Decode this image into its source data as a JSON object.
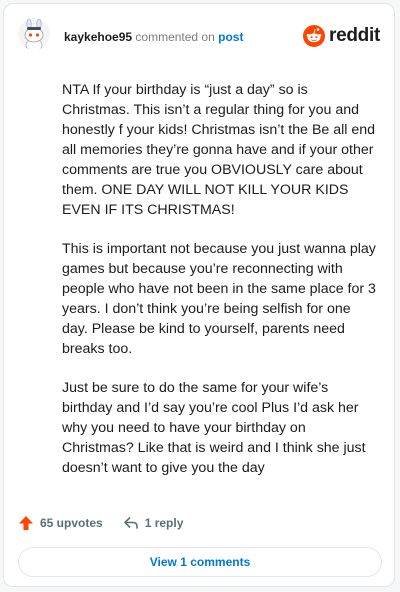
{
  "header": {
    "username": "kaykehoe95",
    "action_text": "commented on",
    "post_link": "post",
    "brand": "reddit"
  },
  "comment": {
    "paragraphs": [
      "NTA If your birthday is “just a day” so is Christmas. This isn’t a regular thing for you and honestly f your kids! Christmas isn’t the Be all end all memories they’re gonna have and if your other comments are true you OBVIOUSLY care about them. ONE DAY WILL NOT KILL YOUR KIDS EVEN IF ITS CHRISTMAS!",
      "This is important not because you just wanna play games but because you’re reconnecting with people who have not been in the same place for 3 years. I don’t think you’re being selfish for one day. Please be kind to yourself, parents need breaks too.",
      "Just be sure to do the same for your wife’s birthday and I’d say you’re cool Plus I’d ask her why you need to have your birthday on Christmas? Like that is weird and I think she just doesn’t want to give you the day"
    ]
  },
  "footer": {
    "upvotes": "65 upvotes",
    "replies": "1 reply",
    "view_comments": "View 1 comments"
  },
  "colors": {
    "brand_orange": "#ff4500",
    "link_blue": "#0079d3",
    "meta_gray": "#576f76"
  },
  "icons": {
    "avatar": "snoo-avatar-icon",
    "logo": "reddit-logo-icon",
    "upvote": "upvote-arrow-icon",
    "reply": "reply-arrow-icon"
  }
}
